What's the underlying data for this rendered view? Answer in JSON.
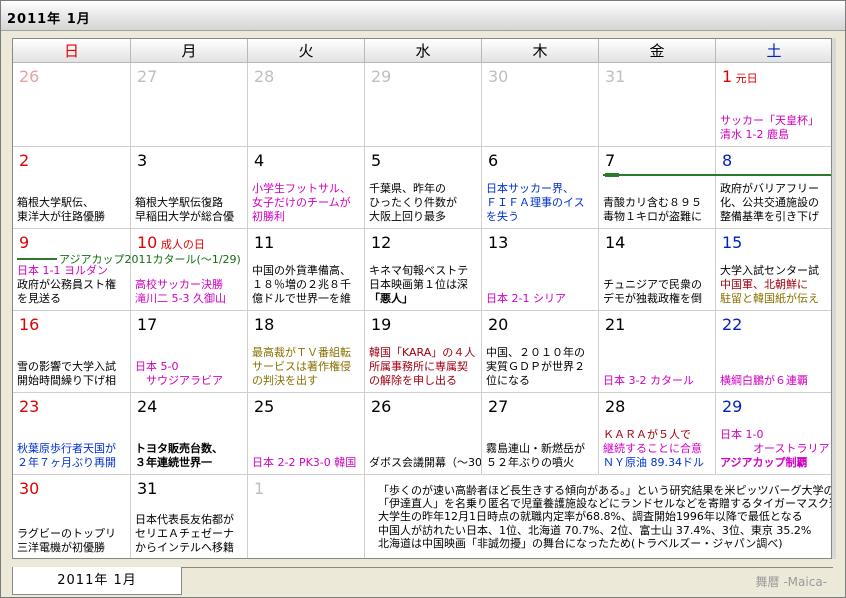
{
  "window": {
    "title": "2011年 1月"
  },
  "weekdays": [
    {
      "label": "日",
      "color": "#e00000"
    },
    {
      "label": "月",
      "color": "#000000"
    },
    {
      "label": "火",
      "color": "#000000"
    },
    {
      "label": "水",
      "color": "#000000"
    },
    {
      "label": "木",
      "color": "#000000"
    },
    {
      "label": "金",
      "color": "#000000"
    },
    {
      "label": "土",
      "color": "#0020c0"
    }
  ],
  "weeks": [
    [
      {
        "day": "26",
        "tone": "pink",
        "lines": []
      },
      {
        "day": "27",
        "tone": "gray",
        "lines": []
      },
      {
        "day": "28",
        "tone": "gray",
        "lines": []
      },
      {
        "day": "29",
        "tone": "gray",
        "lines": []
      },
      {
        "day": "30",
        "tone": "gray",
        "lines": []
      },
      {
        "day": "31",
        "tone": "gray",
        "lines": []
      },
      {
        "day": "1",
        "tone": "red",
        "holiday": "元日",
        "lines": [
          {
            "text": "サッカー「天皇杯」",
            "color": "c-mag"
          },
          {
            "text": "清水 1-2  鹿島",
            "color": "c-mag"
          }
        ]
      }
    ],
    [
      {
        "day": "2",
        "tone": "red",
        "lines": [
          {
            "text": "箱根大学駅伝、",
            "color": "c-black"
          },
          {
            "text": "東洋大が往路優勝",
            "color": "c-black"
          }
        ]
      },
      {
        "day": "3",
        "tone": "",
        "lines": [
          {
            "text": "箱根大学駅伝復路",
            "color": "c-black"
          },
          {
            "text": "早稲田大学が総合優",
            "color": "c-black"
          }
        ]
      },
      {
        "day": "4",
        "tone": "",
        "lines": [
          {
            "text": "小学生フットサル、",
            "color": "c-mag"
          },
          {
            "text": "女子だけのチームが",
            "color": "c-mag"
          },
          {
            "text": "初勝利",
            "color": "c-mag"
          }
        ]
      },
      {
        "day": "5",
        "tone": "",
        "lines": [
          {
            "text": "千葉県、昨年の",
            "color": "c-black"
          },
          {
            "text": "ひったくり件数が",
            "color": "c-black"
          },
          {
            "text": "大阪上回り最多",
            "color": "c-black"
          }
        ]
      },
      {
        "day": "6",
        "tone": "",
        "lines": [
          {
            "text": "日本サッカー界、",
            "color": "c-blue"
          },
          {
            "text": "ＦＩＦＡ理事のイス",
            "color": "c-blue"
          },
          {
            "text": "を失う",
            "color": "c-blue"
          }
        ]
      },
      {
        "day": "7",
        "tone": "",
        "lines": [
          {
            "text": "青酸カリ含む８９５",
            "color": "c-black"
          },
          {
            "text": "毒物１キロが盗難に",
            "color": "c-black"
          }
        ]
      },
      {
        "day": "8",
        "tone": "blue",
        "lines": [
          {
            "text": "政府がバリアフリー",
            "color": "c-black"
          },
          {
            "text": "化、公共交通施設の",
            "color": "c-black"
          },
          {
            "text": "整備基準を引き下げ",
            "color": "c-black"
          }
        ]
      }
    ],
    [
      {
        "day": "9",
        "tone": "red",
        "lines": [
          {
            "text": "日本 1-1  ヨルダン",
            "color": "c-mag"
          },
          {
            "text": "政府が公務員スト権",
            "color": "c-black"
          },
          {
            "text": "を見送る",
            "color": "c-black"
          }
        ]
      },
      {
        "day": "10",
        "tone": "red",
        "holiday": "成人の日",
        "lines": [
          {
            "text": "高校サッカー決勝",
            "color": "c-mag"
          },
          {
            "text": "滝川二 5-3 久御山",
            "color": "c-mag"
          }
        ]
      },
      {
        "day": "11",
        "tone": "",
        "lines": [
          {
            "text": "中国の外貨準備高、",
            "color": "c-black"
          },
          {
            "text": "１８％増の２兆８千",
            "color": "c-black"
          },
          {
            "text": "億ドルで世界一を維",
            "color": "c-black"
          }
        ]
      },
      {
        "day": "12",
        "tone": "",
        "lines": [
          {
            "text": "キネマ旬報ベストテ",
            "color": "c-black"
          },
          {
            "text": "日本映画第１位は深",
            "color": "c-black"
          },
          {
            "text": "「悪人」",
            "color": "c-black",
            "bold": true
          }
        ]
      },
      {
        "day": "13",
        "tone": "",
        "lines": [
          {
            "text": "日本 2-1  シリア",
            "color": "c-mag"
          }
        ]
      },
      {
        "day": "14",
        "tone": "",
        "lines": [
          {
            "text": "チュニジアで民衆の",
            "color": "c-black"
          },
          {
            "text": "デモが独裁政権を倒",
            "color": "c-black"
          }
        ]
      },
      {
        "day": "15",
        "tone": "blue",
        "lines": [
          {
            "text": "大学入試センター試",
            "color": "c-black"
          },
          {
            "text": "中国軍、北朝鮮に",
            "color": "c-dred"
          },
          {
            "text": "駐留と韓国紙が伝え",
            "color": "c-olive"
          }
        ]
      }
    ],
    [
      {
        "day": "16",
        "tone": "red",
        "lines": [
          {
            "text": "雪の影響で大学入試",
            "color": "c-black"
          },
          {
            "text": "開始時間繰り下げ相",
            "color": "c-black"
          }
        ]
      },
      {
        "day": "17",
        "tone": "",
        "lines": [
          {
            "text": "日本 5-0",
            "color": "c-mag"
          },
          {
            "text": "　サウジアラビア",
            "color": "c-mag"
          }
        ]
      },
      {
        "day": "18",
        "tone": "",
        "lines": [
          {
            "text": "最高裁がＴＶ番組転",
            "color": "c-olive"
          },
          {
            "text": "サービスは著作権侵",
            "color": "c-olive"
          },
          {
            "text": "の判決を出す",
            "color": "c-olive"
          }
        ]
      },
      {
        "day": "19",
        "tone": "",
        "lines": [
          {
            "text": "韓国「KARA」の４人",
            "color": "c-dred"
          },
          {
            "text": "所属事務所に専属契",
            "color": "c-dred"
          },
          {
            "text": "の解除を申し出る",
            "color": "c-dred"
          }
        ]
      },
      {
        "day": "20",
        "tone": "",
        "lines": [
          {
            "text": "中国、２０１０年の",
            "color": "c-black"
          },
          {
            "text": "実質ＧＤＰが世界２",
            "color": "c-black"
          },
          {
            "text": "位になる",
            "color": "c-black"
          }
        ]
      },
      {
        "day": "21",
        "tone": "",
        "lines": [
          {
            "text": "日本 3-2  カタール",
            "color": "c-mag"
          }
        ]
      },
      {
        "day": "22",
        "tone": "blue",
        "lines": [
          {
            "text": "横綱白鵬が６連覇",
            "color": "c-mag"
          }
        ]
      }
    ],
    [
      {
        "day": "23",
        "tone": "red",
        "lines": [
          {
            "text": "秋葉原歩行者天国が",
            "color": "c-blue"
          },
          {
            "text": "２年７ヶ月ぶり再開",
            "color": "c-blue"
          }
        ]
      },
      {
        "day": "24",
        "tone": "",
        "lines": [
          {
            "text": "トヨタ販売台数、",
            "color": "c-black",
            "bold": true
          },
          {
            "text": "３年連続世界一",
            "color": "c-black",
            "bold": true
          }
        ]
      },
      {
        "day": "25",
        "tone": "",
        "lines": [
          {
            "text": "日本 2-2 PK3-0  韓国",
            "color": "c-mag"
          }
        ]
      },
      {
        "day": "26",
        "tone": "",
        "lines": [
          {
            "text": "ダボス会議開幕（～30",
            "color": "c-black"
          }
        ]
      },
      {
        "day": "27",
        "tone": "",
        "lines": [
          {
            "text": "霧島連山・新燃岳が",
            "color": "c-black"
          },
          {
            "text": "５２年ぶりの噴火",
            "color": "c-black"
          }
        ]
      },
      {
        "day": "28",
        "tone": "",
        "lines": [
          {
            "text": "ＫＡＲＡが５人で",
            "color": "c-dred"
          },
          {
            "text": "継続することに合意",
            "color": "c-mag"
          },
          {
            "text": "ＮＹ原油 89.34ドル",
            "color": "c-blue"
          }
        ]
      },
      {
        "day": "29",
        "tone": "blue",
        "lines": [
          {
            "text": "日本 1-0",
            "color": "c-mag"
          },
          {
            "text": "　　　オーストラリア",
            "color": "c-mag"
          },
          {
            "text": "アジアカップ制覇",
            "color": "c-mag",
            "bold": true
          }
        ]
      }
    ],
    [
      {
        "day": "30",
        "tone": "red",
        "lines": [
          {
            "text": "ラグビーのトップリ",
            "color": "c-black"
          },
          {
            "text": "三洋電機が初優勝",
            "color": "c-black"
          }
        ]
      },
      {
        "day": "31",
        "tone": "",
        "lines": [
          {
            "text": "日本代表長友佑都が",
            "color": "c-black"
          },
          {
            "text": "セリエＡチェゼーナ",
            "color": "c-black"
          },
          {
            "text": "からインテルへ移籍",
            "color": "c-black"
          }
        ]
      },
      {
        "day": "1",
        "tone": "gray",
        "lines": []
      }
    ]
  ],
  "events": {
    "week1": {
      "label": ""
    },
    "week3": {
      "label": "アジアカップ2011カタール(～1/29)"
    }
  },
  "note": [
    "「歩くのが速い高齢者ほど長生きする傾向がある。」という研究結果を米ピッツバーグ大学の",
    "「伊達直人」を名乗り匿名で児童養護施設などにランドセルなどを寄贈するタイガーマスク運動",
    "大学生の昨年12月1日時点の就職内定率が68.8%、調査開始1996年以降で最低となる",
    "中国人が訪れたい日本、1位、北海道 70.7%、2位、富士山 37.4%、3位、東京 35.2%",
    "北海道は中国映画「非誠勿擾」の舞台になったため(トラベルズー・ジャパン調べ)"
  ],
  "footer": {
    "tab_label": "2011年 1月",
    "brand": "舞暦 -Maica-"
  }
}
